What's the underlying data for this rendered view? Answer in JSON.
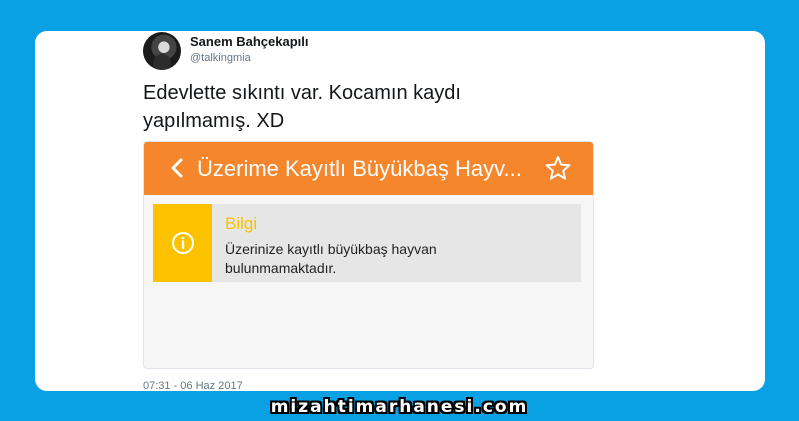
{
  "tweet": {
    "user_name": "Sanem Bahçekapılı",
    "user_handle": "@talkingmia",
    "text_lines": [
      "Edevlette sıkıntı var. Kocamın kaydı",
      "yapılmamış. XD"
    ],
    "timestamp": "07:31 - 06 Haz 2017"
  },
  "app": {
    "title": "Üzerime Kayıtlı Büyükbaş Hayv...",
    "bar_color": "#f5862c",
    "back_icon": "chevron-left",
    "star_icon": "star-outline"
  },
  "info": {
    "title": "Bilgi",
    "message_lines": [
      "Üzerinize kayıtlı büyükbaş hayvan",
      "bulunmamaktadır."
    ],
    "accent_color": "#fcc200",
    "icon": "info-circle"
  },
  "watermark": "mizahtimarhanesi.com",
  "colors": {
    "background": "#0aa0e4",
    "card": "#ffffff"
  }
}
